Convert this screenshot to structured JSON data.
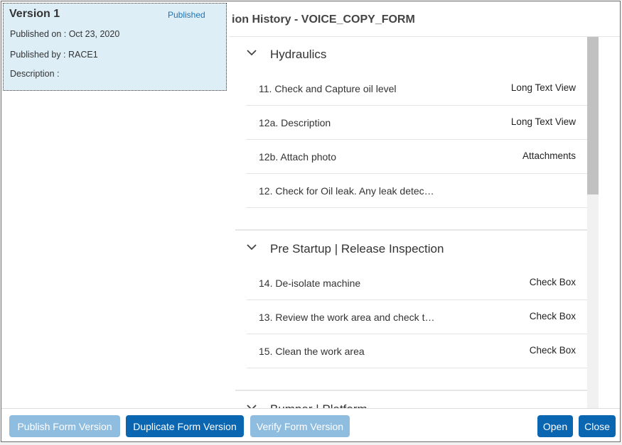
{
  "modal": {
    "title": "ion History - VOICE_COPY_FORM"
  },
  "version_card": {
    "title": "Version 1",
    "status": "Published",
    "published_on": "Published on : Oct 23, 2020",
    "published_by": "Published by : RACE1",
    "description": "Description :"
  },
  "sections": [
    {
      "title": "Hydraulics",
      "items": [
        {
          "label": "11. Check and Capture oil level",
          "type": "Long Text View"
        },
        {
          "label": "12a. Description",
          "type": "Long Text View"
        },
        {
          "label": "12b. Attach photo",
          "type": "Attachments"
        },
        {
          "label": "12. Check for Oil leak. Any leak detec…",
          "type": ""
        }
      ]
    },
    {
      "title": "Pre Startup | Release Inspection",
      "items": [
        {
          "label": "14. De-isolate machine",
          "type": "Check Box"
        },
        {
          "label": "13. Review the work area and check t…",
          "type": "Check Box"
        },
        {
          "label": "15. Clean the work area",
          "type": "Check Box"
        }
      ]
    },
    {
      "title": "Bumper | Platform",
      "items": []
    }
  ],
  "footer": {
    "publish": "Publish Form Version",
    "duplicate": "Duplicate Form Version",
    "verify": "Verify Form Version",
    "open": "Open",
    "close": "Close"
  },
  "icons": {
    "section_toggle": "chevron-down-icon"
  },
  "colors": {
    "accent": "#0b66b2",
    "accent_disabled": "#8fbde0",
    "selected_card": "#ddeef7",
    "status_link": "#1d73b8"
  }
}
